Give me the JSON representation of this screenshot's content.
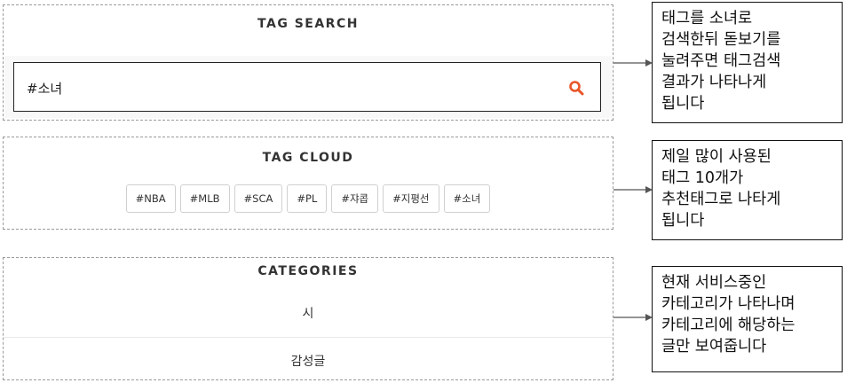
{
  "tag_search": {
    "title": "TAG SEARCH",
    "input_value": "#소녀",
    "search_icon": "search-icon",
    "accent_color": "#e8562a"
  },
  "tag_cloud": {
    "title": "TAG CLOUD",
    "tags": [
      "#NBA",
      "#MLB",
      "#SCA",
      "#PL",
      "#쟈콥",
      "#지평선",
      "#소녀"
    ]
  },
  "categories": {
    "title": "CATEGORIES",
    "items": [
      "시",
      "감성글"
    ]
  },
  "notes": {
    "search": "태그를 소녀로\n검색한뒤 돋보기를\n눌려주면 태그검색\n결과가 나타나게\n됩니다",
    "cloud": "제일 많이 사용된\n태그 10개가\n추천태그로 나타게\n됩니다",
    "categories": "현재 서비스중인\n카테고리가 나타나며\n카테고리에 해당하는\n글만 보여줍니다"
  }
}
